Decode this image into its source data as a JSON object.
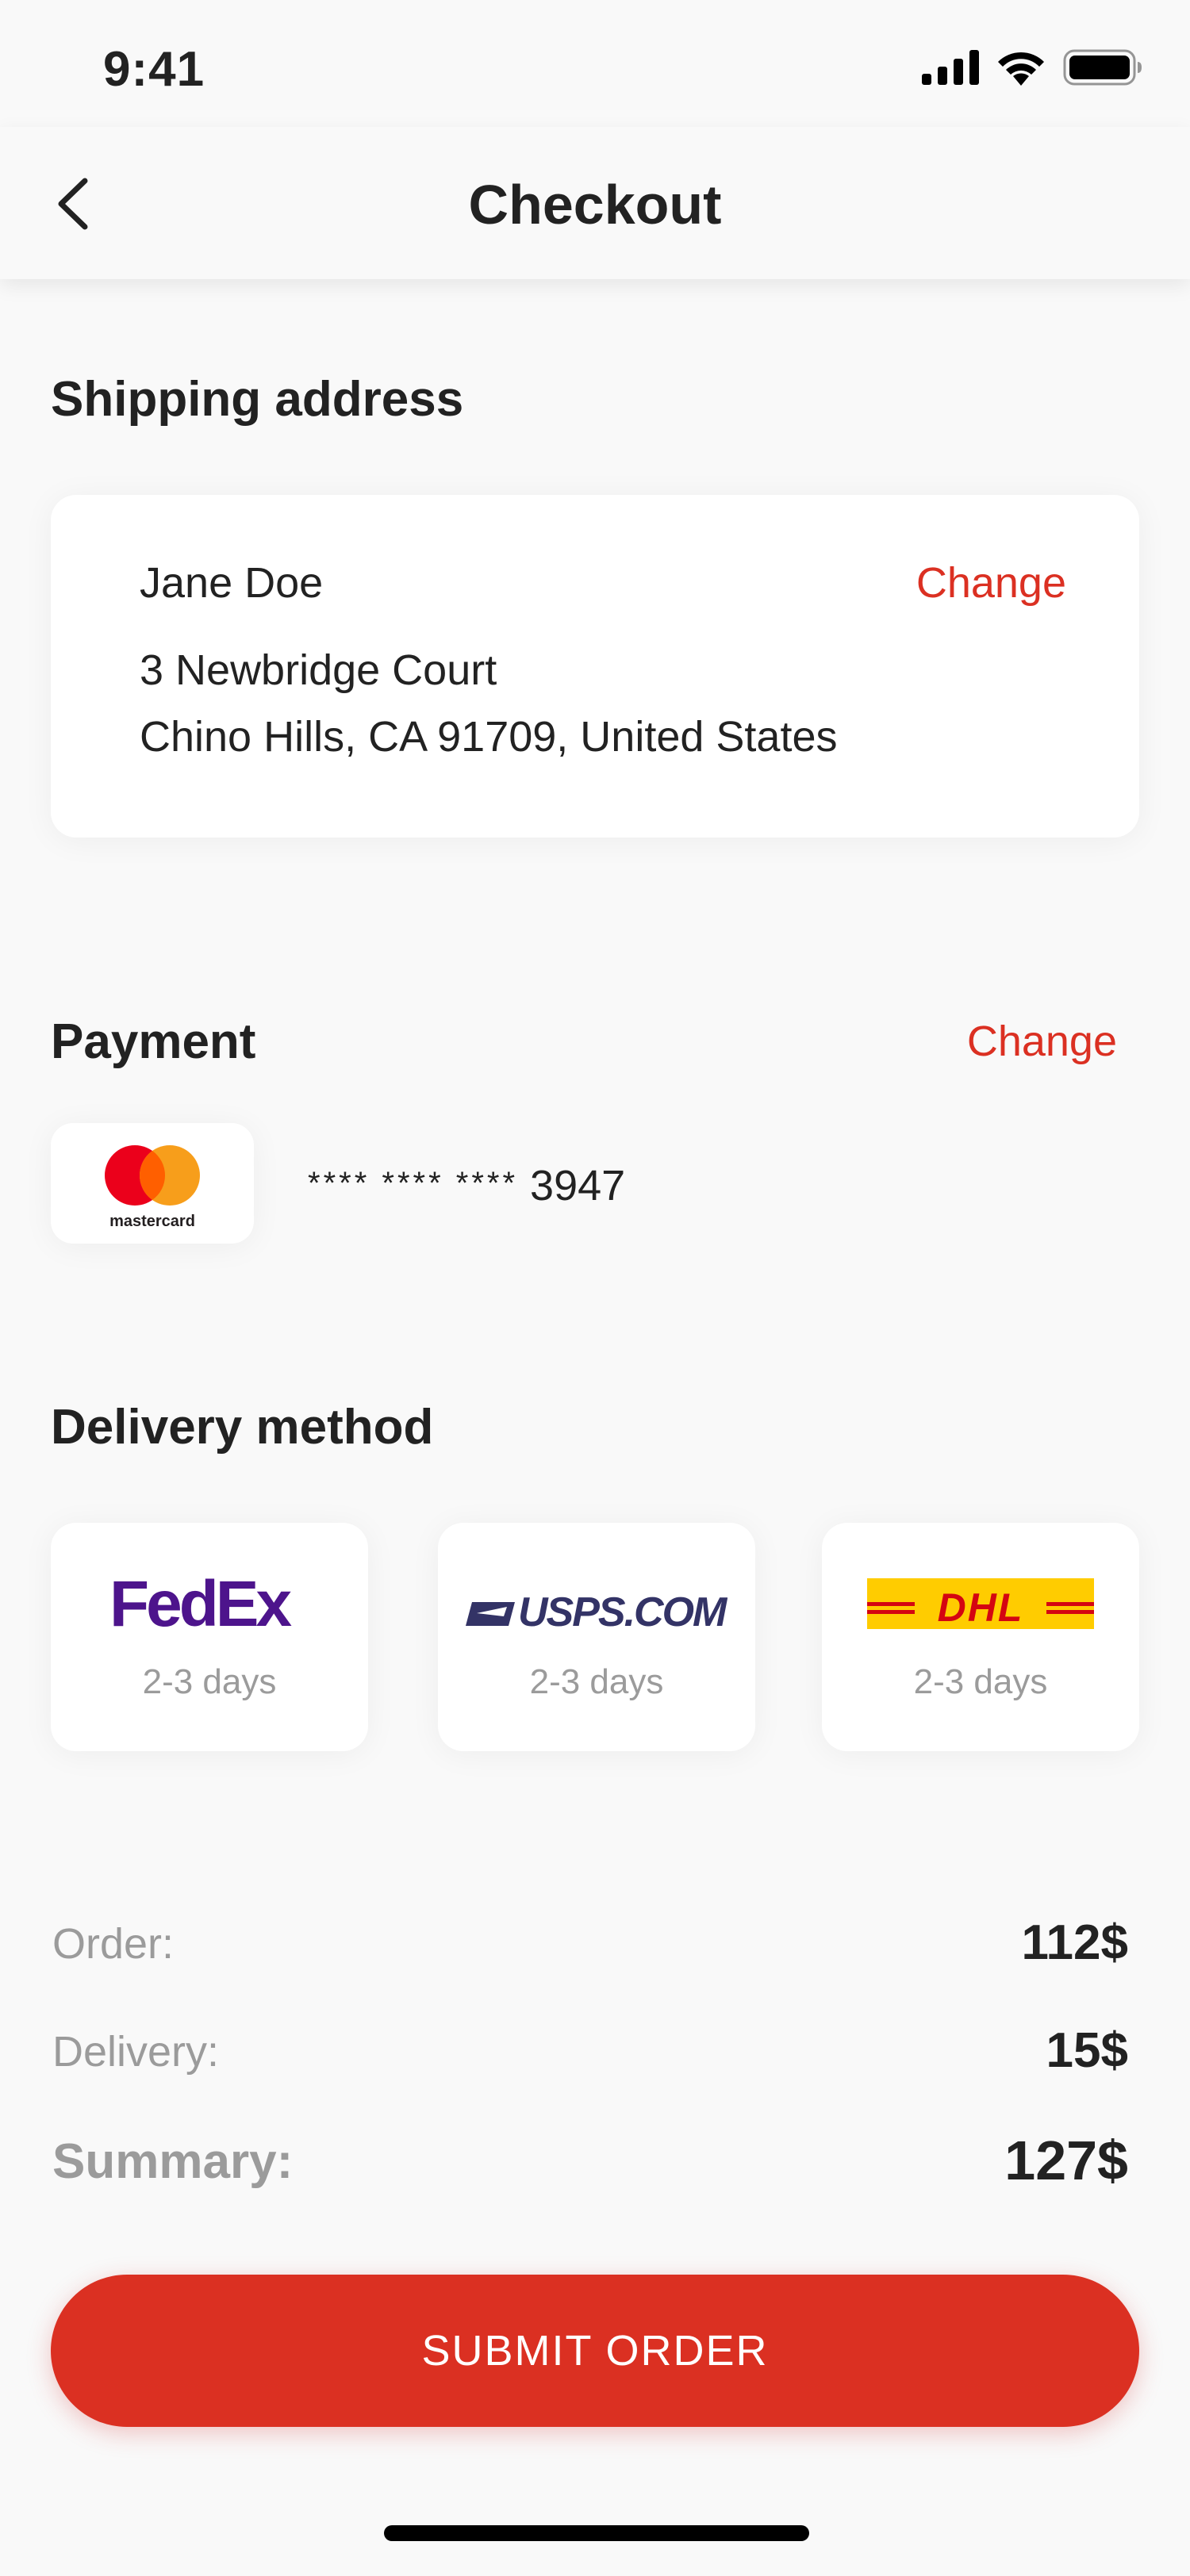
{
  "status_bar": {
    "time": "9:41",
    "icons": [
      "signal-icon",
      "wifi-icon",
      "battery-icon"
    ]
  },
  "header": {
    "title": "Checkout",
    "back_icon": "chevron-left-icon"
  },
  "shipping": {
    "title": "Shipping address",
    "name": "Jane Doe",
    "change_label": "Change",
    "address_line1": "3 Newbridge Court",
    "address_line2": "Chino Hills, CA 91709, United States"
  },
  "payment": {
    "title": "Payment",
    "change_label": "Change",
    "card_brand": "mastercard",
    "card_mask": "**** **** ****",
    "card_last4": "3947"
  },
  "delivery": {
    "title": "Delivery method",
    "options": [
      {
        "carrier": "FedEx",
        "days": "2-3 days"
      },
      {
        "carrier": "USPS.COM",
        "days": "2-3 days"
      },
      {
        "carrier": "DHL",
        "days": "2-3 days"
      }
    ]
  },
  "summary": {
    "order_label": "Order:",
    "order_value": "112$",
    "delivery_label": "Delivery:",
    "delivery_value": "15$",
    "summary_label": "Summary:",
    "summary_value": "127$"
  },
  "submit_label": "SUBMIT ORDER",
  "colors": {
    "accent": "#db3022",
    "background": "#f9f9f9",
    "muted": "#9b9b9b"
  }
}
